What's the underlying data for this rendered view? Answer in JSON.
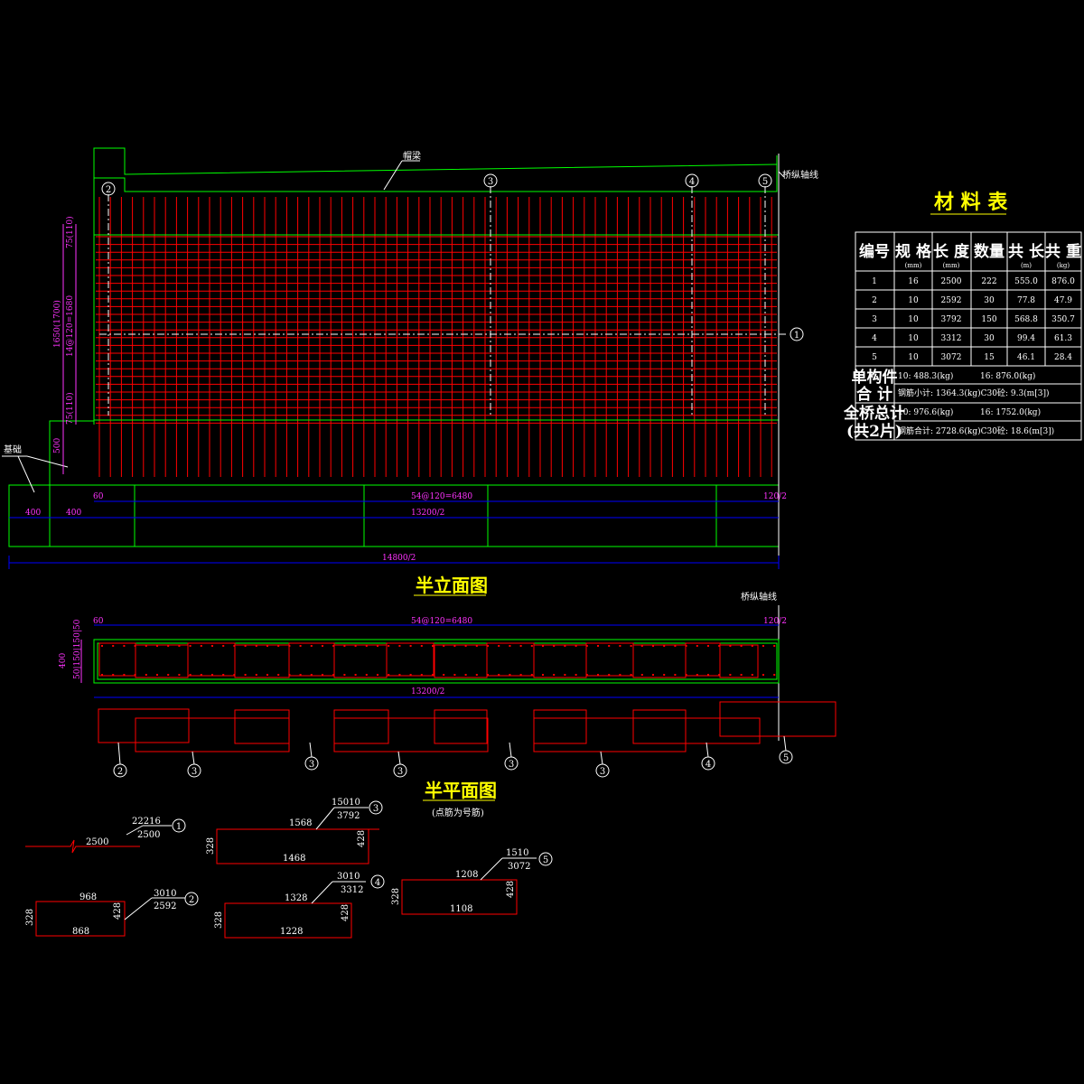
{
  "colors": {
    "rebar": "#ff0000",
    "outline": "#00ff00",
    "dim": "#0000ff",
    "dimtext": "#ff33ff",
    "title": "#ffff00",
    "text": "#ffffff"
  },
  "elevation": {
    "title": "半立面图",
    "label_cap_beam": "帽梁",
    "label_foundation": "基础",
    "label_axis_top": "桥纵轴线",
    "label_axis_mid": "桥纵轴线",
    "markers_top": [
      "2",
      "3",
      "4",
      "5"
    ],
    "marker_right": "1",
    "vdim_1": "75(110)",
    "vdim_2": "1650(1700)",
    "vdim_3": "14@120=1680",
    "vdim_4": "75(110)",
    "vdim_5": "500",
    "hdim_60": "60",
    "hdim_spacing": "54@120=6480",
    "hdim_half120": "120/2",
    "hdim_400a": "400",
    "hdim_400b": "400",
    "hdim_13200": "13200/2",
    "hdim_14800": "14800/2"
  },
  "plan": {
    "title": "半平面图",
    "subtitle": "(点筋为号筋)",
    "hdim_60": "60",
    "hdim_spacing": "54@120=6480",
    "hdim_half120": "120/2",
    "vdim_400": "400",
    "vdim_sub": "50|150|150|50",
    "hdim_13200": "13200/2",
    "markers": [
      "2",
      "3",
      "3",
      "3",
      "3",
      "3",
      "4",
      "5"
    ]
  },
  "bars": {
    "b1": {
      "num": "1",
      "top": "22216",
      "bottom": "2500",
      "len": "2500"
    },
    "b2": {
      "num": "2",
      "top": "3010",
      "bottom": "2592",
      "dim_top": "968",
      "dim_bot": "868",
      "dim_left": "328",
      "dim_right": "428"
    },
    "b3": {
      "num": "3",
      "top": "15010",
      "bottom": "3792",
      "dim_top": "1568",
      "dim_bot": "1468",
      "dim_left": "328",
      "dim_right": "428"
    },
    "b4": {
      "num": "4",
      "top": "3010",
      "bottom": "3312",
      "dim_top": "1328",
      "dim_bot": "1228",
      "dim_left": "328",
      "dim_right": "428"
    },
    "b5": {
      "num": "5",
      "top": "1510",
      "bottom": "3072",
      "dim_top": "1208",
      "dim_bot": "1108",
      "dim_left": "328",
      "dim_right": "428"
    }
  },
  "table": {
    "title": "材 料 表",
    "headers": [
      {
        "main": "编号",
        "unit": ""
      },
      {
        "main": "规 格",
        "unit": "(mm)"
      },
      {
        "main": "长 度",
        "unit": "(mm)"
      },
      {
        "main": "数量",
        "unit": ""
      },
      {
        "main": "共 长",
        "unit": "(m)"
      },
      {
        "main": "共 重",
        "unit": "(kg)"
      }
    ],
    "rows": [
      [
        "1",
        "16",
        "2500",
        "222",
        "555.0",
        "876.0"
      ],
      [
        "2",
        "10",
        "2592",
        "30",
        "77.8",
        "47.9"
      ],
      [
        "3",
        "10",
        "3792",
        "150",
        "568.8",
        "350.7"
      ],
      [
        "4",
        "10",
        "3312",
        "30",
        "99.4",
        "61.3"
      ],
      [
        "5",
        "10",
        "3072",
        "15",
        "46.1",
        "28.4"
      ]
    ],
    "sum1_label_a": "单构件",
    "sum1_label_b": "合 计",
    "sum1_line1_a": "10: 488.3(kg)",
    "sum1_line1_b": "16: 876.0(kg)",
    "sum1_line2": "钢筋小计: 1364.3(kg)C30砼: 9.3(m[3])",
    "sum2_label_a": "全桥总计",
    "sum2_label_b": "(共2片)",
    "sum2_line1_a": "10: 976.6(kg)",
    "sum2_line1_b": "16: 1752.0(kg)",
    "sum2_line2": "钢筋合计: 2728.6(kg)C30砼: 18.6(m[3])"
  }
}
